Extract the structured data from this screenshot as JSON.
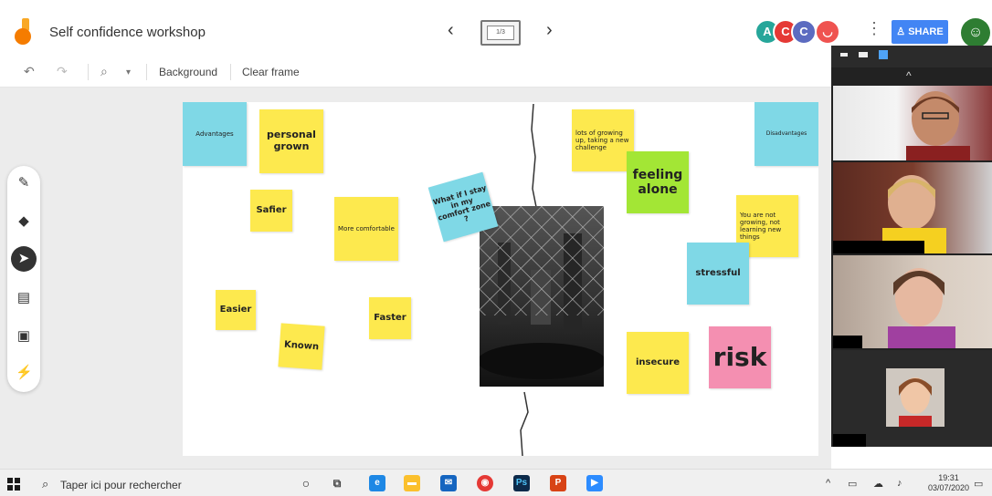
{
  "header": {
    "title": "Self confidence workshop",
    "frame_indicator": "1/3",
    "share_label": "SHARE",
    "prev_label": "‹",
    "next_label": "›",
    "more_label": "⋮",
    "collaborators": [
      {
        "initial": "A",
        "color": "#26a69a"
      },
      {
        "initial": "C",
        "color": "#e53935"
      },
      {
        "initial": "C",
        "color": "#5c6bc0"
      },
      {
        "initial": "◡",
        "color": "#ef5350"
      }
    ]
  },
  "toolbar": {
    "undo_icon": "↶",
    "redo_icon": "↷",
    "zoom_icon": "⌕",
    "zoom_dropdown": "▾",
    "background_label": "Background",
    "clear_frame_label": "Clear frame"
  },
  "side_tools": [
    {
      "name": "pen-tool",
      "glyph": "✎"
    },
    {
      "name": "eraser-tool",
      "glyph": "◆"
    },
    {
      "name": "select-tool",
      "glyph": "➤"
    },
    {
      "name": "sticky-note-tool",
      "glyph": "▤"
    },
    {
      "name": "image-tool",
      "glyph": "▣"
    },
    {
      "name": "laser-tool",
      "glyph": "⚡"
    }
  ],
  "board": {
    "notes": [
      {
        "id": "advantages",
        "text": "Advantages",
        "color": "cyan"
      },
      {
        "id": "personal-grown",
        "text": "personal grown",
        "color": "yellow"
      },
      {
        "id": "safier",
        "text": "Safier",
        "color": "yellow"
      },
      {
        "id": "more-comfortable",
        "text": "More comfortable",
        "color": "yellow"
      },
      {
        "id": "easier",
        "text": "Easier",
        "color": "yellow"
      },
      {
        "id": "known",
        "text": "Known",
        "color": "yellow"
      },
      {
        "id": "faster",
        "text": "Faster",
        "color": "yellow"
      },
      {
        "id": "what-if",
        "text": "What if I stay in my comfort zone ?",
        "color": "cyan"
      },
      {
        "id": "lots-of-growing",
        "text": "lots of growing up, taking a new challenge",
        "color": "yellow"
      },
      {
        "id": "feeling-alone",
        "text": "feeling alone",
        "color": "lime"
      },
      {
        "id": "disadvantages",
        "text": "Disadvantages",
        "color": "cyan"
      },
      {
        "id": "not-growing",
        "text": "You are not growing, not learning new things",
        "color": "yellow"
      },
      {
        "id": "stressful",
        "text": "stressful",
        "color": "cyan"
      },
      {
        "id": "insecure",
        "text": "insecure",
        "color": "yellow"
      },
      {
        "id": "risk",
        "text": "risk",
        "color": "pink"
      }
    ]
  },
  "video_panel": {
    "chevron": "^"
  },
  "taskbar": {
    "search_placeholder": "Taper ici pour rechercher",
    "time": "19:31",
    "date": "03/07/2020"
  }
}
